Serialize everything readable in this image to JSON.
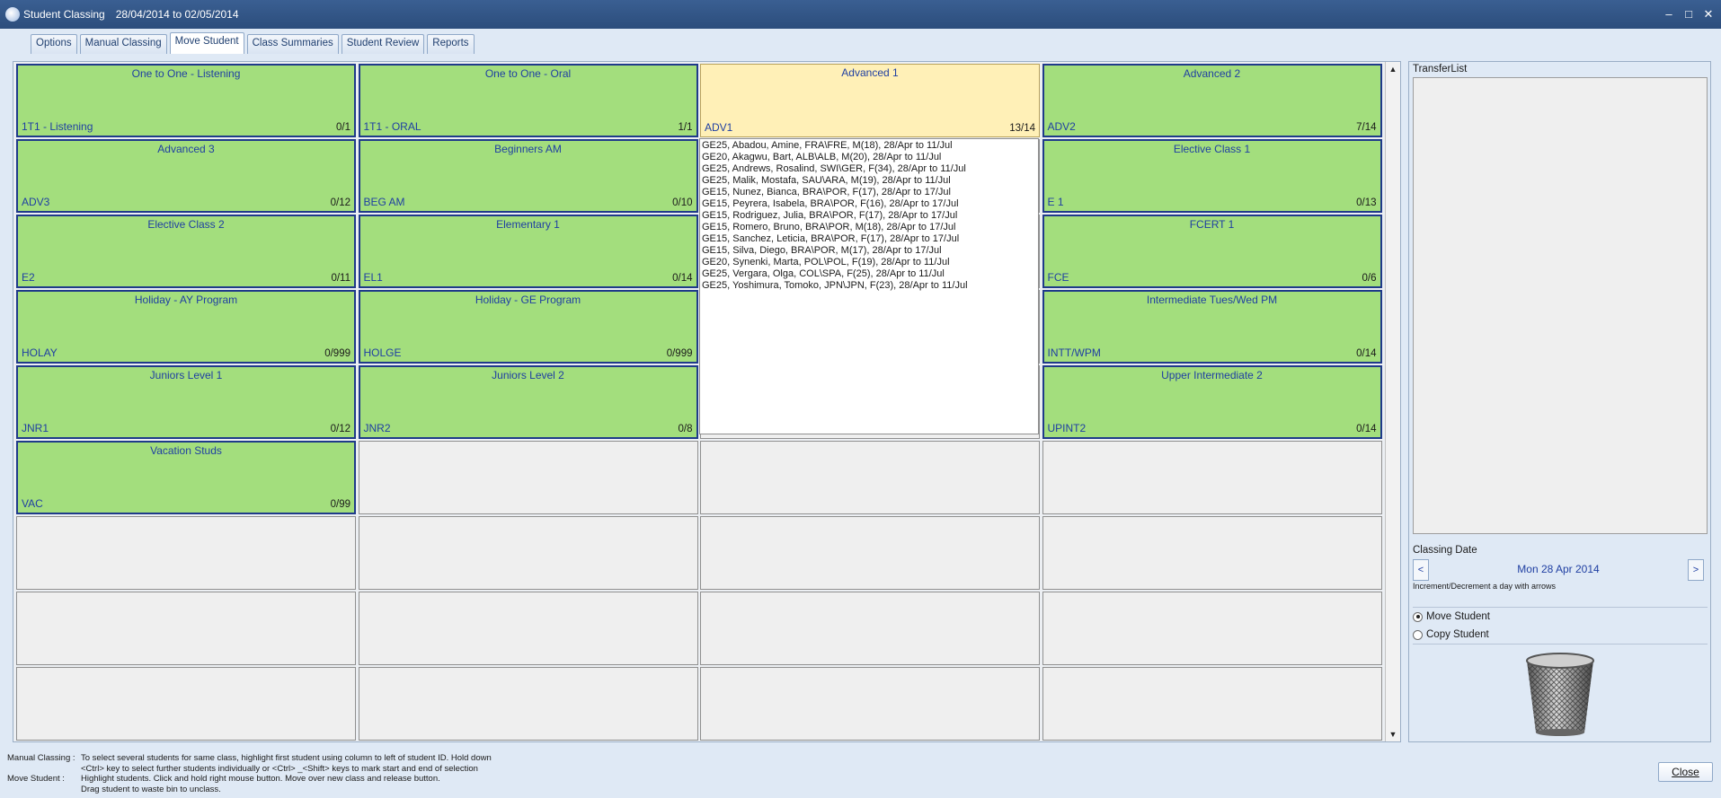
{
  "window": {
    "title": "Student Classing",
    "dates": "28/04/2014 to 02/05/2014",
    "controls": {
      "minimize": "–",
      "maximize": "□",
      "close": "✕"
    }
  },
  "tabs": [
    {
      "label": "Options"
    },
    {
      "label": "Manual Classing"
    },
    {
      "label": "Move Student",
      "active": true
    },
    {
      "label": "Class Summaries"
    },
    {
      "label": "Student Review"
    },
    {
      "label": "Reports"
    }
  ],
  "classes": [
    {
      "name": "One to One - Listening",
      "code": "1T1 - Listening",
      "count": "0/1"
    },
    {
      "name": "One to One - Oral",
      "code": "1T1 - ORAL",
      "count": "1/1"
    },
    {
      "name": "Advanced 1",
      "code": "ADV1",
      "count": "13/14",
      "selected": true
    },
    {
      "name": "Advanced 2",
      "code": "ADV2",
      "count": "7/14"
    },
    {
      "name": "Advanced 3",
      "code": "ADV3",
      "count": "0/12"
    },
    {
      "name": "Beginners AM",
      "code": "BEG AM",
      "count": "0/10"
    },
    {
      "name": "",
      "code": "",
      "count": "",
      "covered": true
    },
    {
      "name": "Elective Class 1",
      "code": "E 1",
      "count": "0/13"
    },
    {
      "name": "Elective Class 2",
      "code": "E2",
      "count": "0/11"
    },
    {
      "name": "Elementary 1",
      "code": "EL1",
      "count": "0/14"
    },
    {
      "name": "",
      "code": "",
      "count": "",
      "covered": true
    },
    {
      "name": "FCERT 1",
      "code": "FCE",
      "count": "0/6"
    },
    {
      "name": "Holiday - AY Program",
      "code": "HOLAY",
      "count": "0/999"
    },
    {
      "name": "Holiday - GE Program",
      "code": "HOLGE",
      "count": "0/999"
    },
    {
      "name": "",
      "code": "",
      "count": "",
      "covered": true
    },
    {
      "name": "Intermediate Tues/Wed PM",
      "code": "INTT/WPM",
      "count": "0/14"
    },
    {
      "name": "Juniors Level 1",
      "code": "JNR1",
      "count": "0/12"
    },
    {
      "name": "Juniors Level 2",
      "code": "JNR2",
      "count": "0/8"
    },
    {
      "name": "",
      "code": "",
      "count": "",
      "covered": true
    },
    {
      "name": "Upper Intermediate 2",
      "code": "UPINT2",
      "count": "0/14"
    },
    {
      "name": "Vacation Studs",
      "code": "VAC",
      "count": "0/99"
    }
  ],
  "students": [
    "GE25, Abadou, Amine, FRA\\FRE, M(18), 28/Apr to 11/Jul",
    "GE20, Akagwu, Bart, ALB\\ALB, M(20), 28/Apr to 11/Jul",
    "GE25, Andrews, Rosalind, SWI\\GER, F(34), 28/Apr to 11/Jul",
    "GE25, Malik, Mostafa, SAU\\ARA, M(19), 28/Apr to 11/Jul",
    "GE15, Nunez, Bianca, BRA\\POR, F(17), 28/Apr to 17/Jul",
    "GE15, Peyrera, Isabela, BRA\\POR, F(16), 28/Apr to 17/Jul",
    "GE15, Rodriguez, Julia, BRA\\POR, F(17), 28/Apr to 17/Jul",
    "GE15, Romero, Bruno, BRA\\POR, M(18), 28/Apr to 17/Jul",
    "GE15, Sanchez, Leticia, BRA\\POR, F(17), 28/Apr to 17/Jul",
    "GE15, Silva, Diego, BRA\\POR, M(17), 28/Apr to 17/Jul",
    "GE20, Synenki, Marta, POL\\POL, F(19), 28/Apr to 11/Jul",
    "GE25, Vergara, Olga, COL\\SPA, F(25), 28/Apr to 11/Jul",
    "GE25, Yoshimura, Tomoko, JPN\\JPN, F(23), 28/Apr to 11/Jul"
  ],
  "scroll": {
    "up": "▲",
    "down": "▼"
  },
  "side": {
    "transfer_label": "TransferList",
    "classing_date_label": "Classing Date",
    "prev": "<",
    "next": ">",
    "date": "Mon 28 Apr 2014",
    "hint": "Increment/Decrement a day with arrows",
    "move": "Move Student",
    "copy": "Copy Student"
  },
  "help": {
    "manual_key": "Manual Classing :",
    "manual_lines": [
      "To select several students for same class, highlight first student using column to left of student ID. Hold down",
      "<Ctrl>  key to select further students individually or <Ctrl> _<Shift>  keys to mark start and end of selection"
    ],
    "move_key": "Move Student :",
    "move_lines": [
      "Highlight students. Click and hold right mouse button. Move over new class and release button.",
      "Drag student to waste bin to unclass."
    ]
  },
  "close_label": "Close"
}
